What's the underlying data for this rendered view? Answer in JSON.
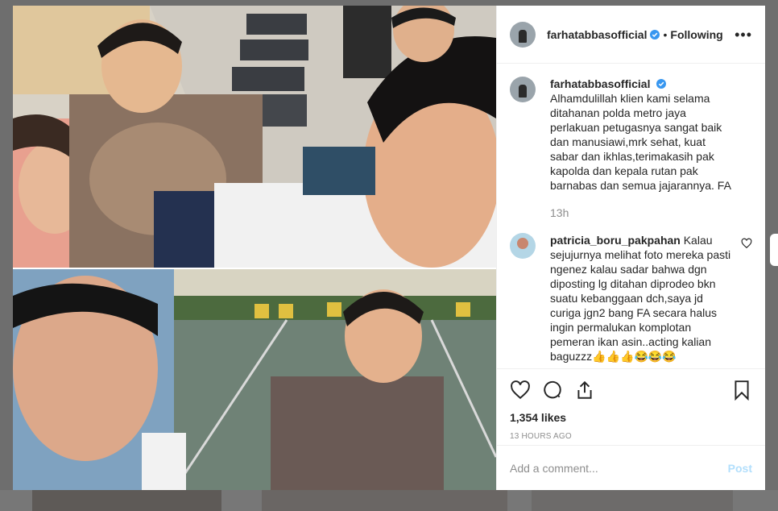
{
  "post": {
    "username": "farhatabbasofficial",
    "follow_dot": "•",
    "follow_state": "Following",
    "more_label": "•••"
  },
  "caption": {
    "username": "farhatabbasofficial",
    "text": "Alhamdulillah klien kami selama ditahanan polda metro jaya perlakuan petugasnya sangat baik dan manusiawi,mrk sehat, kuat sabar dan ikhlas,terimakasih pak kapolda dan kepala rutan pak barnabas dan semua jajarannya. FA",
    "time": "13h"
  },
  "comments": [
    {
      "username": "patricia_boru_pakpahan",
      "text": "Kalau sejujurnya melihat foto mereka pasti ngenez kalau sadar bahwa dgn diposting lg ditahan diprodeo bkn suatu kebanggaan dch,saya jd curiga jgn2 bang FA secara halus ingin permalukan komplotan pemeran ikan asin..acting kalian baguzzz👍👍👍😂😂😂"
    }
  ],
  "stats": {
    "likes": "1,354 likes",
    "timestamp": "13 HOURS AGO"
  },
  "comment_box": {
    "placeholder": "Add a comment...",
    "post_label": "Post"
  },
  "icons": {
    "like": "heart-icon",
    "comment": "comment-icon",
    "share": "share-icon",
    "save": "bookmark-icon",
    "verified": "verified-badge-icon",
    "more": "more-options-icon"
  },
  "colors": {
    "verified": "#3897f0",
    "post_button_disabled": "#b2dffc",
    "text": "#262626",
    "muted": "#8e8e8e"
  }
}
